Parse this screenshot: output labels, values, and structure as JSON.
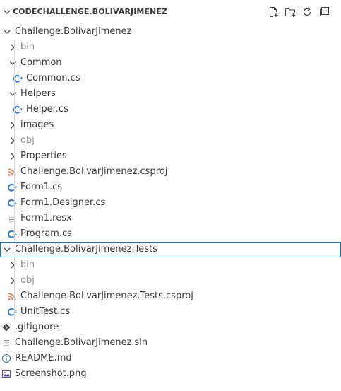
{
  "explorer": {
    "title": "CODECHALLENGE.BOLIVARJIMENEZ",
    "actions": [
      {
        "name": "new-file-icon"
      },
      {
        "name": "new-folder-icon"
      },
      {
        "name": "refresh-icon"
      },
      {
        "name": "collapse-all-icon"
      }
    ]
  },
  "tree": [
    {
      "label": "Challenge.BolivarJimenez",
      "depth": 0,
      "kind": "folder",
      "expanded": true,
      "icon": "chevron-down-icon"
    },
    {
      "label": "bin",
      "depth": 1,
      "kind": "folder",
      "expanded": false,
      "dim": true,
      "icon": "chevron-right-icon"
    },
    {
      "label": "Common",
      "depth": 1,
      "kind": "folder",
      "expanded": true,
      "icon": "chevron-down-icon"
    },
    {
      "label": "Common.cs",
      "depth": 2,
      "kind": "file",
      "icon": "csharp-file-icon"
    },
    {
      "label": "Helpers",
      "depth": 1,
      "kind": "folder",
      "expanded": true,
      "icon": "chevron-down-icon"
    },
    {
      "label": "Helper.cs",
      "depth": 2,
      "kind": "file",
      "icon": "csharp-file-icon"
    },
    {
      "label": "images",
      "depth": 1,
      "kind": "folder",
      "expanded": false,
      "icon": "chevron-right-icon"
    },
    {
      "label": "obj",
      "depth": 1,
      "kind": "folder",
      "expanded": false,
      "dim": true,
      "icon": "chevron-right-icon"
    },
    {
      "label": "Properties",
      "depth": 1,
      "kind": "folder",
      "expanded": false,
      "icon": "chevron-right-icon"
    },
    {
      "label": "Challenge.BolivarJimenez.csproj",
      "depth": 1,
      "kind": "file",
      "icon": "rss-project-icon"
    },
    {
      "label": "Form1.cs",
      "depth": 1,
      "kind": "file",
      "icon": "csharp-file-icon"
    },
    {
      "label": "Form1.Designer.cs",
      "depth": 1,
      "kind": "file",
      "icon": "csharp-file-icon"
    },
    {
      "label": "Form1.resx",
      "depth": 1,
      "kind": "file",
      "icon": "lines-file-icon"
    },
    {
      "label": "Program.cs",
      "depth": 1,
      "kind": "file",
      "icon": "csharp-file-icon"
    },
    {
      "label": "Challenge.BolivarJimenez.Tests",
      "depth": 0,
      "kind": "folder",
      "expanded": true,
      "selected": true,
      "icon": "chevron-down-icon"
    },
    {
      "label": "bin",
      "depth": 1,
      "kind": "folder",
      "expanded": false,
      "dim": true,
      "icon": "chevron-right-icon"
    },
    {
      "label": "obj",
      "depth": 1,
      "kind": "folder",
      "expanded": false,
      "dim": true,
      "icon": "chevron-right-icon"
    },
    {
      "label": "Challenge.BolivarJimenez.Tests.csproj",
      "depth": 1,
      "kind": "file",
      "icon": "rss-project-icon"
    },
    {
      "label": "UnitTest.cs",
      "depth": 1,
      "kind": "file",
      "icon": "csharp-file-icon"
    },
    {
      "label": ".gitignore",
      "depth": 0,
      "kind": "file",
      "icon": "git-diamond-icon"
    },
    {
      "label": "Challenge.BolivarJimenez.sln",
      "depth": 0,
      "kind": "file",
      "icon": "lines-file-icon"
    },
    {
      "label": "README.md",
      "depth": 0,
      "kind": "file",
      "icon": "info-icon"
    },
    {
      "label": "Screenshot.png",
      "depth": 0,
      "kind": "file",
      "icon": "image-file-icon"
    }
  ],
  "colors": {
    "csharp": "#3178c6",
    "project": "#e37933",
    "selection-border": "#0078d4",
    "dim-text": "#8e8e8e"
  }
}
